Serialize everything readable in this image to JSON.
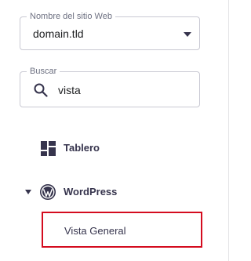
{
  "site_select": {
    "legend": "Nombre del sitio Web",
    "value": "domain.tld",
    "icon": "chevron-down-icon"
  },
  "search": {
    "legend": "Buscar",
    "value": "vista",
    "icon": "search-icon"
  },
  "nav": {
    "items": [
      {
        "label": "Tablero",
        "icon": "dashboard-icon"
      },
      {
        "label": "WordPress",
        "icon": "wordpress-icon",
        "expanded": true
      }
    ],
    "sub_items": [
      {
        "label": "Vista General",
        "highlighted": true
      }
    ]
  },
  "colors": {
    "text": "#36344d",
    "highlight_border": "#d40c1f",
    "field_border": "#c9c9d3"
  }
}
